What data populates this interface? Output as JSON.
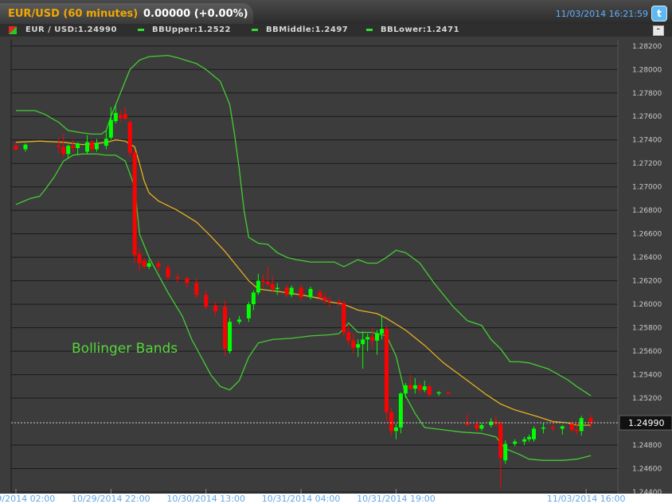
{
  "header": {
    "symbol_title": "EUR/USD (60 minutes)",
    "change": "0.00000 (+0.00%)",
    "timestamp": "11/03/2014 16:21:59",
    "twitter_icon": "twitter-icon"
  },
  "legend": {
    "ohlc": "EUR / USD:1.24990",
    "bb_upper": "BBUpper:1.2522",
    "bb_middle": "BBMiddle:1.2497",
    "bb_lower": "BBLower:1.2471",
    "minimize_icon": "minimize-icon"
  },
  "colors": {
    "up": "#00ff00",
    "down": "#ff0000",
    "bands": "#44cc33",
    "middle": "#e8b020",
    "background": "#3c3c3c",
    "grid": "#1a1a1a"
  },
  "chart_data": {
    "type": "candlestick",
    "title": "EUR/USD (60 minutes)",
    "annotation": "Bollinger Bands",
    "last_price": "1.24990",
    "ylim": [
      1.244,
      1.2828
    ],
    "y_ticks": [
      "1.24400",
      "1.24600",
      "1.24800",
      "1.25200",
      "1.25400",
      "1.25600",
      "1.25800",
      "1.26000",
      "1.26200",
      "1.26400",
      "1.26600",
      "1.26800",
      "1.27000",
      "1.27200",
      "1.27400",
      "1.27600",
      "1.27800",
      "1.28000",
      "1.28200"
    ],
    "x_ticks": [
      "10/29/2014 02:00",
      "10/29/2014 22:00",
      "10/30/2014 13:00",
      "10/31/2014 04:00",
      "10/31/2014 19:00",
      "11/03/2014 16:00"
    ],
    "x_tick_index": [
      0,
      20,
      40,
      60,
      80,
      120
    ],
    "n_bars": 126,
    "candles": [
      {
        "i": 0,
        "o": 1.2735,
        "h": 1.2738,
        "l": 1.2731,
        "c": 1.2732
      },
      {
        "i": 2,
        "o": 1.2732,
        "h": 1.2737,
        "l": 1.273,
        "c": 1.2736
      },
      {
        "i": 9,
        "o": 1.2735,
        "h": 1.2742,
        "l": 1.2728,
        "c": 1.2734
      },
      {
        "i": 10,
        "o": 1.2734,
        "h": 1.2745,
        "l": 1.2725,
        "c": 1.2728
      },
      {
        "i": 11,
        "o": 1.2728,
        "h": 1.2736,
        "l": 1.2724,
        "c": 1.2735
      },
      {
        "i": 12,
        "o": 1.2735,
        "h": 1.274,
        "l": 1.273,
        "c": 1.2733
      },
      {
        "i": 13,
        "o": 1.2733,
        "h": 1.2738,
        "l": 1.2727,
        "c": 1.2737
      },
      {
        "i": 15,
        "o": 1.273,
        "h": 1.2744,
        "l": 1.2728,
        "c": 1.2738
      },
      {
        "i": 16,
        "o": 1.2738,
        "h": 1.274,
        "l": 1.273,
        "c": 1.2732
      },
      {
        "i": 17,
        "o": 1.2732,
        "h": 1.2741,
        "l": 1.273,
        "c": 1.2737
      },
      {
        "i": 19,
        "o": 1.2735,
        "h": 1.2748,
        "l": 1.2732,
        "c": 1.2741
      },
      {
        "i": 20,
        "o": 1.2742,
        "h": 1.2768,
        "l": 1.274,
        "c": 1.2757
      },
      {
        "i": 21,
        "o": 1.2756,
        "h": 1.277,
        "l": 1.2754,
        "c": 1.2763
      },
      {
        "i": 22,
        "o": 1.2761,
        "h": 1.2765,
        "l": 1.2755,
        "c": 1.2759
      },
      {
        "i": 23,
        "o": 1.2762,
        "h": 1.2768,
        "l": 1.2757,
        "c": 1.2758
      },
      {
        "i": 24,
        "o": 1.2755,
        "h": 1.2757,
        "l": 1.2725,
        "c": 1.2729
      },
      {
        "i": 25,
        "o": 1.2729,
        "h": 1.2732,
        "l": 1.2635,
        "c": 1.2642
      },
      {
        "i": 26,
        "o": 1.2643,
        "h": 1.2648,
        "l": 1.2628,
        "c": 1.2635
      },
      {
        "i": 27,
        "o": 1.2637,
        "h": 1.264,
        "l": 1.263,
        "c": 1.2632
      },
      {
        "i": 28,
        "o": 1.2632,
        "h": 1.2638,
        "l": 1.263,
        "c": 1.2635
      },
      {
        "i": 30,
        "o": 1.2635,
        "h": 1.2637,
        "l": 1.2628,
        "c": 1.2632
      },
      {
        "i": 32,
        "o": 1.2631,
        "h": 1.2634,
        "l": 1.262,
        "c": 1.2623
      },
      {
        "i": 34,
        "o": 1.2623,
        "h": 1.2626,
        "l": 1.2618,
        "c": 1.2622
      },
      {
        "i": 36,
        "o": 1.2622,
        "h": 1.2624,
        "l": 1.2614,
        "c": 1.2618
      },
      {
        "i": 38,
        "o": 1.2618,
        "h": 1.2622,
        "l": 1.2605,
        "c": 1.2608
      },
      {
        "i": 40,
        "o": 1.2608,
        "h": 1.2612,
        "l": 1.2596,
        "c": 1.2598
      },
      {
        "i": 42,
        "o": 1.2599,
        "h": 1.2602,
        "l": 1.259,
        "c": 1.2594
      },
      {
        "i": 44,
        "o": 1.2598,
        "h": 1.2603,
        "l": 1.2556,
        "c": 1.2562
      },
      {
        "i": 45,
        "o": 1.256,
        "h": 1.2588,
        "l": 1.2558,
        "c": 1.2585
      },
      {
        "i": 47,
        "o": 1.2585,
        "h": 1.259,
        "l": 1.2583,
        "c": 1.2587
      },
      {
        "i": 49,
        "o": 1.2588,
        "h": 1.2602,
        "l": 1.2585,
        "c": 1.26
      },
      {
        "i": 50,
        "o": 1.26,
        "h": 1.2612,
        "l": 1.2595,
        "c": 1.261
      },
      {
        "i": 51,
        "o": 1.261,
        "h": 1.2626,
        "l": 1.2608,
        "c": 1.262
      },
      {
        "i": 52,
        "o": 1.262,
        "h": 1.2625,
        "l": 1.2614,
        "c": 1.2619
      },
      {
        "i": 53,
        "o": 1.2619,
        "h": 1.2632,
        "l": 1.2615,
        "c": 1.2617
      },
      {
        "i": 54,
        "o": 1.2617,
        "h": 1.2624,
        "l": 1.261,
        "c": 1.2613
      },
      {
        "i": 55,
        "o": 1.2613,
        "h": 1.2618,
        "l": 1.2608,
        "c": 1.2614
      },
      {
        "i": 57,
        "o": 1.2614,
        "h": 1.2617,
        "l": 1.2606,
        "c": 1.2608
      },
      {
        "i": 58,
        "o": 1.2608,
        "h": 1.2616,
        "l": 1.2606,
        "c": 1.2614
      },
      {
        "i": 60,
        "o": 1.2614,
        "h": 1.2617,
        "l": 1.2603,
        "c": 1.2606
      },
      {
        "i": 62,
        "o": 1.2606,
        "h": 1.2615,
        "l": 1.2604,
        "c": 1.2613
      },
      {
        "i": 64,
        "o": 1.261,
        "h": 1.2613,
        "l": 1.2603,
        "c": 1.2606
      },
      {
        "i": 65,
        "o": 1.2606,
        "h": 1.261,
        "l": 1.26,
        "c": 1.2603
      },
      {
        "i": 66,
        "o": 1.2603,
        "h": 1.2607,
        "l": 1.2597,
        "c": 1.2602
      },
      {
        "i": 68,
        "o": 1.2602,
        "h": 1.2605,
        "l": 1.2598,
        "c": 1.2601
      },
      {
        "i": 69,
        "o": 1.2601,
        "h": 1.2603,
        "l": 1.2572,
        "c": 1.2576
      },
      {
        "i": 70,
        "o": 1.2576,
        "h": 1.2582,
        "l": 1.2565,
        "c": 1.2569
      },
      {
        "i": 71,
        "o": 1.2569,
        "h": 1.2575,
        "l": 1.2558,
        "c": 1.2563
      },
      {
        "i": 72,
        "o": 1.2563,
        "h": 1.257,
        "l": 1.2555,
        "c": 1.2566
      },
      {
        "i": 73,
        "o": 1.2566,
        "h": 1.2577,
        "l": 1.2545,
        "c": 1.257
      },
      {
        "i": 74,
        "o": 1.257,
        "h": 1.2575,
        "l": 1.256,
        "c": 1.2572
      },
      {
        "i": 75,
        "o": 1.2572,
        "h": 1.258,
        "l": 1.2562,
        "c": 1.2569
      },
      {
        "i": 76,
        "o": 1.2569,
        "h": 1.2578,
        "l": 1.2557,
        "c": 1.2575
      },
      {
        "i": 77,
        "o": 1.2575,
        "h": 1.259,
        "l": 1.257,
        "c": 1.2579
      },
      {
        "i": 78,
        "o": 1.2579,
        "h": 1.2582,
        "l": 1.25,
        "c": 1.2508
      },
      {
        "i": 79,
        "o": 1.2508,
        "h": 1.2512,
        "l": 1.2488,
        "c": 1.2492
      },
      {
        "i": 80,
        "o": 1.2492,
        "h": 1.2498,
        "l": 1.2485,
        "c": 1.2495
      },
      {
        "i": 81,
        "o": 1.2495,
        "h": 1.2525,
        "l": 1.249,
        "c": 1.2524
      },
      {
        "i": 82,
        "o": 1.2524,
        "h": 1.2533,
        "l": 1.252,
        "c": 1.2531
      },
      {
        "i": 83,
        "o": 1.2531,
        "h": 1.254,
        "l": 1.2527,
        "c": 1.2528
      },
      {
        "i": 84,
        "o": 1.2528,
        "h": 1.2537,
        "l": 1.2524,
        "c": 1.2531
      },
      {
        "i": 85,
        "o": 1.2531,
        "h": 1.2533,
        "l": 1.2524,
        "c": 1.2527
      },
      {
        "i": 86,
        "o": 1.2527,
        "h": 1.2535,
        "l": 1.2525,
        "c": 1.253
      },
      {
        "i": 87,
        "o": 1.253,
        "h": 1.2532,
        "l": 1.2521,
        "c": 1.2523
      },
      {
        "i": 89,
        "o": 1.2524,
        "h": 1.2526,
        "l": 1.2522,
        "c": 1.2525
      },
      {
        "i": 91,
        "o": 1.2525,
        "h": 1.2526,
        "l": 1.2523,
        "c": 1.2524
      },
      {
        "i": 95,
        "o": 1.2499,
        "h": 1.2506,
        "l": 1.2497,
        "c": 1.2497
      },
      {
        "i": 97,
        "o": 1.2498,
        "h": 1.2501,
        "l": 1.2491,
        "c": 1.2494
      },
      {
        "i": 98,
        "o": 1.2494,
        "h": 1.2499,
        "l": 1.2492,
        "c": 1.2497
      },
      {
        "i": 100,
        "o": 1.2497,
        "h": 1.2503,
        "l": 1.2495,
        "c": 1.25
      },
      {
        "i": 101,
        "o": 1.25,
        "h": 1.2505,
        "l": 1.2496,
        "c": 1.2498
      },
      {
        "i": 102,
        "o": 1.2498,
        "h": 1.25,
        "l": 1.2444,
        "c": 1.2469
      },
      {
        "i": 103,
        "o": 1.2467,
        "h": 1.2484,
        "l": 1.2464,
        "c": 1.2481
      },
      {
        "i": 105,
        "o": 1.2481,
        "h": 1.2485,
        "l": 1.2479,
        "c": 1.2483
      },
      {
        "i": 107,
        "o": 1.2483,
        "h": 1.2487,
        "l": 1.248,
        "c": 1.2485
      },
      {
        "i": 108,
        "o": 1.2485,
        "h": 1.2489,
        "l": 1.2483,
        "c": 1.2487
      },
      {
        "i": 109,
        "o": 1.2485,
        "h": 1.2496,
        "l": 1.2483,
        "c": 1.2494
      },
      {
        "i": 111,
        "o": 1.2494,
        "h": 1.2499,
        "l": 1.249,
        "c": 1.2495
      },
      {
        "i": 113,
        "o": 1.2495,
        "h": 1.25,
        "l": 1.2492,
        "c": 1.2494
      },
      {
        "i": 115,
        "o": 1.2494,
        "h": 1.2497,
        "l": 1.2489,
        "c": 1.2496
      },
      {
        "i": 117,
        "o": 1.2498,
        "h": 1.2501,
        "l": 1.2491,
        "c": 1.2493
      },
      {
        "i": 118,
        "o": 1.2493,
        "h": 1.2499,
        "l": 1.2489,
        "c": 1.2492
      },
      {
        "i": 119,
        "o": 1.2492,
        "h": 1.2505,
        "l": 1.2488,
        "c": 1.2503
      },
      {
        "i": 121,
        "o": 1.2503,
        "h": 1.2506,
        "l": 1.2494,
        "c": 1.2499
      }
    ],
    "series": [
      {
        "name": "BBUpper",
        "values": [
          [
            0,
            1.2765
          ],
          [
            4,
            1.2765
          ],
          [
            6,
            1.2762
          ],
          [
            9,
            1.2755
          ],
          [
            11,
            1.2748
          ],
          [
            14,
            1.2746
          ],
          [
            16,
            1.2745
          ],
          [
            18,
            1.2745
          ],
          [
            19,
            1.2748
          ],
          [
            20,
            1.276
          ],
          [
            22,
            1.278
          ],
          [
            24,
            1.28
          ],
          [
            26,
            1.2808
          ],
          [
            28,
            1.2811
          ],
          [
            32,
            1.2812
          ],
          [
            34,
            1.281
          ],
          [
            38,
            1.2805
          ],
          [
            40,
            1.28
          ],
          [
            43,
            1.279
          ],
          [
            45,
            1.277
          ],
          [
            46,
            1.2745
          ],
          [
            47,
            1.2715
          ],
          [
            48,
            1.268
          ],
          [
            49,
            1.2657
          ],
          [
            51,
            1.2652
          ],
          [
            53,
            1.2651
          ],
          [
            55,
            1.2644
          ],
          [
            57,
            1.264
          ],
          [
            59,
            1.2638
          ],
          [
            62,
            1.2636
          ],
          [
            65,
            1.2636
          ],
          [
            67,
            1.2636
          ],
          [
            69,
            1.2632
          ],
          [
            72,
            1.2638
          ],
          [
            74,
            1.2635
          ],
          [
            76,
            1.2635
          ],
          [
            78,
            1.264
          ],
          [
            80,
            1.2646
          ],
          [
            82,
            1.2644
          ],
          [
            85,
            1.2635
          ],
          [
            88,
            1.2618
          ],
          [
            92,
            1.2598
          ],
          [
            95,
            1.2586
          ],
          [
            98,
            1.2582
          ],
          [
            100,
            1.257
          ],
          [
            102,
            1.2562
          ],
          [
            104,
            1.2551
          ],
          [
            106,
            1.2551
          ],
          [
            108,
            1.255
          ],
          [
            112,
            1.2545
          ],
          [
            116,
            1.2536
          ],
          [
            118,
            1.253
          ],
          [
            121,
            1.2522
          ]
        ]
      },
      {
        "name": "BBMiddle",
        "values": [
          [
            0,
            1.2738
          ],
          [
            5,
            1.2739
          ],
          [
            10,
            1.2738
          ],
          [
            14,
            1.2736
          ],
          [
            17,
            1.2737
          ],
          [
            19,
            1.2738
          ],
          [
            21,
            1.274
          ],
          [
            23,
            1.2739
          ],
          [
            25,
            1.2734
          ],
          [
            26,
            1.272
          ],
          [
            27,
            1.2705
          ],
          [
            28,
            1.2695
          ],
          [
            30,
            1.2688
          ],
          [
            34,
            1.268
          ],
          [
            38,
            1.267
          ],
          [
            41,
            1.2658
          ],
          [
            44,
            1.2645
          ],
          [
            47,
            1.263
          ],
          [
            49,
            1.262
          ],
          [
            51,
            1.2613
          ],
          [
            55,
            1.2611
          ],
          [
            60,
            1.2608
          ],
          [
            64,
            1.2605
          ],
          [
            66,
            1.2602
          ],
          [
            69,
            1.26
          ],
          [
            72,
            1.2595
          ],
          [
            76,
            1.2592
          ],
          [
            78,
            1.2588
          ],
          [
            82,
            1.2578
          ],
          [
            86,
            1.2565
          ],
          [
            90,
            1.255
          ],
          [
            95,
            1.2535
          ],
          [
            99,
            1.2523
          ],
          [
            102,
            1.2515
          ],
          [
            105,
            1.251
          ],
          [
            110,
            1.2504
          ],
          [
            113,
            1.25
          ],
          [
            116,
            1.2499
          ],
          [
            118,
            1.2497
          ],
          [
            121,
            1.2497
          ]
        ]
      },
      {
        "name": "BBLower",
        "values": [
          [
            0,
            1.2685
          ],
          [
            3,
            1.269
          ],
          [
            5,
            1.2692
          ],
          [
            6,
            1.2697
          ],
          [
            8,
            1.2708
          ],
          [
            10,
            1.2722
          ],
          [
            12,
            1.2727
          ],
          [
            14,
            1.2728
          ],
          [
            17,
            1.2728
          ],
          [
            19,
            1.2727
          ],
          [
            21,
            1.2727
          ],
          [
            23,
            1.2722
          ],
          [
            25,
            1.27
          ],
          [
            26,
            1.266
          ],
          [
            28,
            1.264
          ],
          [
            30,
            1.2625
          ],
          [
            32,
            1.261
          ],
          [
            35,
            1.259
          ],
          [
            37,
            1.257
          ],
          [
            39,
            1.2555
          ],
          [
            41,
            1.254
          ],
          [
            43,
            1.253
          ],
          [
            45,
            1.2527
          ],
          [
            47,
            1.2535
          ],
          [
            49,
            1.2555
          ],
          [
            51,
            1.2567
          ],
          [
            54,
            1.257
          ],
          [
            58,
            1.2571
          ],
          [
            62,
            1.2573
          ],
          [
            66,
            1.2574
          ],
          [
            68,
            1.2575
          ],
          [
            70,
            1.2584
          ],
          [
            72,
            1.2576
          ],
          [
            75,
            1.2576
          ],
          [
            78,
            1.2573
          ],
          [
            80,
            1.2556
          ],
          [
            82,
            1.2522
          ],
          [
            84,
            1.2507
          ],
          [
            86,
            1.2495
          ],
          [
            90,
            1.2493
          ],
          [
            94,
            1.2491
          ],
          [
            98,
            1.249
          ],
          [
            101,
            1.2487
          ],
          [
            103,
            1.2477
          ],
          [
            106,
            1.2472
          ],
          [
            108,
            1.2468
          ],
          [
            111,
            1.2467
          ],
          [
            115,
            1.2467
          ],
          [
            118,
            1.2468
          ],
          [
            121,
            1.2471
          ]
        ]
      }
    ]
  }
}
